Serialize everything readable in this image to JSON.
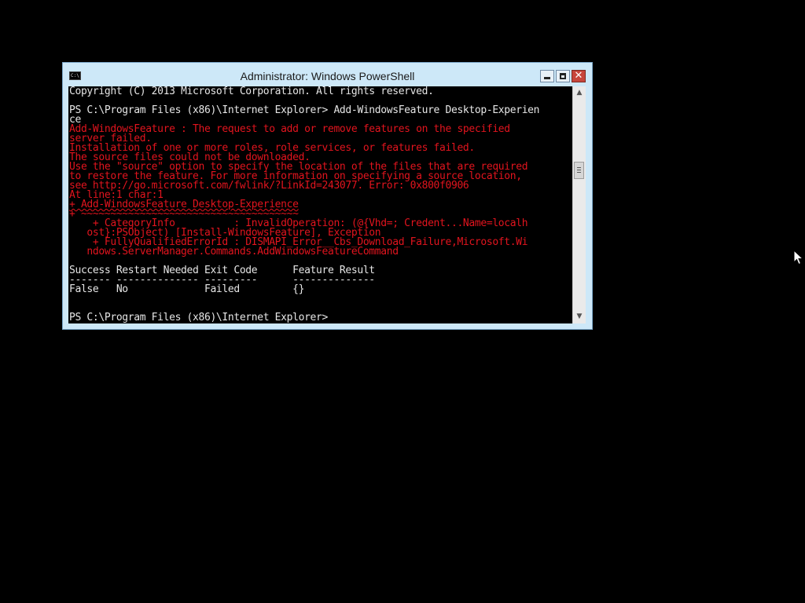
{
  "window": {
    "title": "Administrator: Windows PowerShell",
    "icon": "powershell-console-icon",
    "minimize_icon": "minimize-icon",
    "maximize_icon": "maximize-icon",
    "close_icon": "close-icon",
    "close_glyph": "✕",
    "icon_text": "C:\\",
    "close_color": "#c7463c",
    "frame_color": "#cde8f8"
  },
  "console": {
    "background": "#000000",
    "foreground": "#e6e6e6",
    "error_color": "#e2141e",
    "lines": [
      {
        "text": "Copyright (C) 2013 Microsoft Corporation. All rights reserved.",
        "kind": "out"
      },
      {
        "text": "",
        "kind": "out"
      },
      {
        "text": "PS C:\\Program Files (x86)\\Internet Explorer> Add-WindowsFeature Desktop-Experien",
        "kind": "out"
      },
      {
        "text": "ce",
        "kind": "out"
      },
      {
        "text": "Add-WindowsFeature : The request to add or remove features on the specified",
        "kind": "err"
      },
      {
        "text": "server failed.",
        "kind": "err"
      },
      {
        "text": "Installation of one or more roles, role services, or features failed.",
        "kind": "err"
      },
      {
        "text": "The source files could not be downloaded.",
        "kind": "err"
      },
      {
        "text": "Use the \"source\" option to specify the location of the files that are required",
        "kind": "err"
      },
      {
        "text": "to restore the feature. For more information on specifying a source location,",
        "kind": "err"
      },
      {
        "text": "see http://go.microsoft.com/fwlink/?LinkId=243077. Error: 0x800f0906",
        "kind": "err"
      },
      {
        "text": "At line:1 char:1",
        "kind": "err"
      },
      {
        "text": "+ Add-WindowsFeature Desktop-Experience",
        "kind": "err"
      },
      {
        "text": "+ ~~~~~~~~~~~~~~~~~~~~~~~~~~~~~~~~~~~~~",
        "kind": "err"
      },
      {
        "text": "    + CategoryInfo          : InvalidOperation: (@{Vhd=; Credent...Name=localh",
        "kind": "err"
      },
      {
        "text": "   ost}:PSObject) [Install-WindowsFeature], Exception",
        "kind": "err"
      },
      {
        "text": "    + FullyQualifiedErrorId : DISMAPI_Error__Cbs_Download_Failure,Microsoft.Wi",
        "kind": "err"
      },
      {
        "text": "   ndows.ServerManager.Commands.AddWindowsFeatureCommand",
        "kind": "err"
      },
      {
        "text": "",
        "kind": "out"
      },
      {
        "text": "Success Restart Needed Exit Code      Feature Result",
        "kind": "out"
      },
      {
        "text": "------- -------------- ---------      --------------",
        "kind": "out"
      },
      {
        "text": "False   No             Failed         {}",
        "kind": "out"
      },
      {
        "text": "",
        "kind": "out"
      },
      {
        "text": "",
        "kind": "out"
      },
      {
        "text": "PS C:\\Program Files (x86)\\Internet Explorer>",
        "kind": "out"
      }
    ]
  },
  "scrollbar": {
    "up_icon": "scroll-up-arrow-icon",
    "down_icon": "scroll-down-arrow-icon",
    "up_glyph": "▲",
    "down_glyph": "▼"
  },
  "cursor": {
    "icon": "mouse-pointer-icon"
  }
}
